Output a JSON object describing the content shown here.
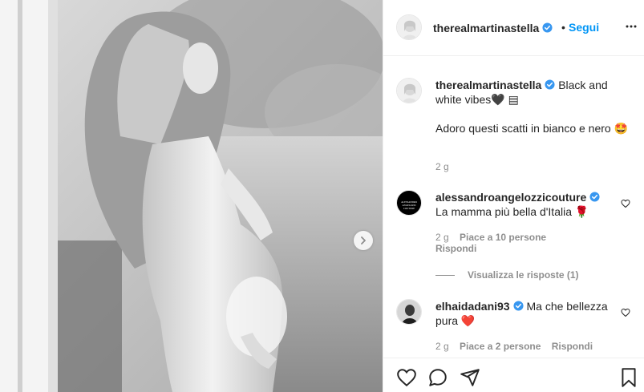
{
  "post": {
    "username": "therealmartinastella",
    "dot": "•",
    "follow_label": "Segui",
    "caption_line1": "Black and white vibes🖤 ▤",
    "caption_line2": "Adoro questi scatti in bianco e nero 🤩",
    "caption_age": "2 g"
  },
  "comments": [
    {
      "username": "alessandroangelozzicouture",
      "text": "La mamma più bella d'Italia 🌹",
      "age": "2 g",
      "likes": "Piace a 10 persone",
      "reply": "Rispondi",
      "avatar_text": "ALESSANDRO ANGELOZZI COUTURE"
    },
    {
      "username": "elhaidadani93",
      "text": "Ma che bellezza pura ❤️",
      "age": "2 g",
      "likes": "Piace a 2 persone",
      "reply": "Rispondi"
    }
  ],
  "view_replies": "Visualizza le risposte (1)",
  "colors": {
    "accent": "#0095f6",
    "verified": "#3897f0",
    "muted": "#8e8e8e",
    "text": "#262626"
  },
  "icons": [
    "verified-badge-icon",
    "more-options-icon",
    "heart-icon",
    "comment-icon",
    "share-icon",
    "save-icon",
    "chevron-right-icon"
  ]
}
